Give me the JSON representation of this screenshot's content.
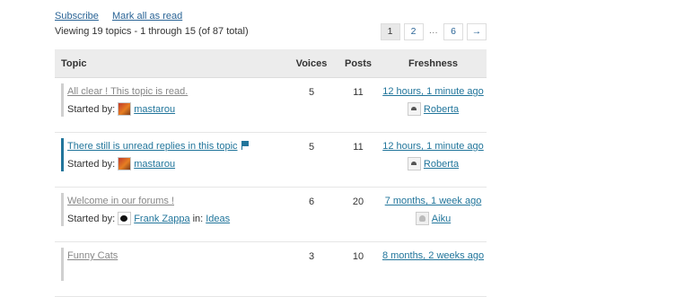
{
  "links": {
    "subscribe": "Subscribe",
    "mark_all_read": "Mark all as read"
  },
  "summary": "Viewing 19 topics - 1 through 15 (of 87 total)",
  "pagination": {
    "current": "1",
    "p2": "2",
    "dots": "…",
    "last": "6",
    "next": "→"
  },
  "columns": {
    "topic": "Topic",
    "voices": "Voices",
    "posts": "Posts",
    "freshness": "Freshness"
  },
  "started_by": "Started by:",
  "in_label": "in:",
  "topics": [
    {
      "title": "All clear ! This topic is read.",
      "author": "mastarou",
      "voices": "5",
      "posts": "11",
      "freshness": "12 hours, 1 minute ago",
      "last_user": "Roberta"
    },
    {
      "title": "There still is unread replies in this topic",
      "author": "mastarou",
      "voices": "5",
      "posts": "11",
      "freshness": "12 hours, 1 minute ago",
      "last_user": "Roberta"
    },
    {
      "title": "Welcome in our forums !",
      "author": "Frank Zappa",
      "forum": "Ideas",
      "voices": "6",
      "posts": "20",
      "freshness": "7 months, 1 week ago",
      "last_user": "Aiku"
    },
    {
      "title": "Funny Cats",
      "voices": "3",
      "posts": "10",
      "freshness": "8 months, 2 weeks ago"
    }
  ],
  "colors": {
    "link": "#21759b",
    "unread_bar": "#21759b",
    "read_bar": "#d0d0d0",
    "header_bg": "#ececec"
  }
}
